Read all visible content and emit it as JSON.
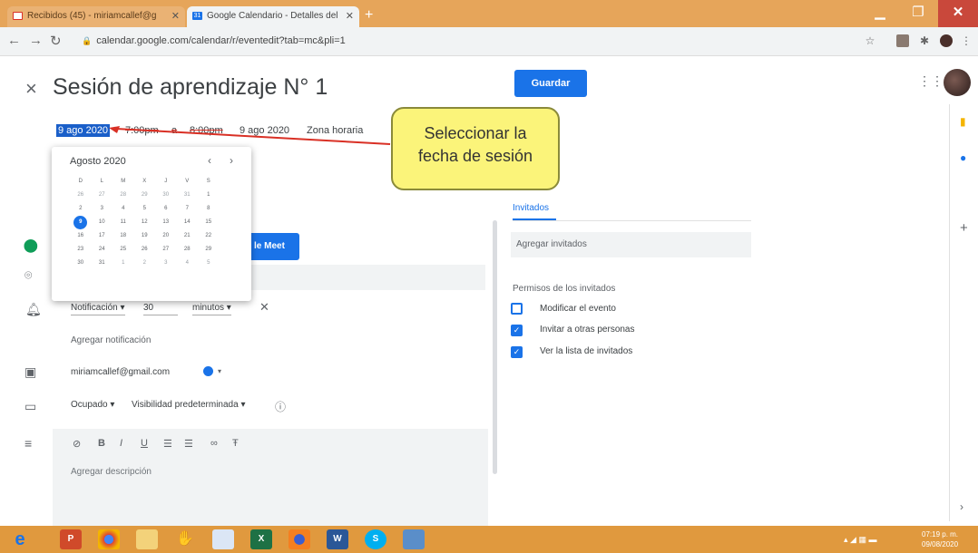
{
  "browser": {
    "tabs": [
      {
        "title": "Recibidos (45) - miriamcallef@g",
        "active": false
      },
      {
        "title": "Google Calendario - Detalles del",
        "active": true
      }
    ],
    "url": "calendar.google.com/calendar/r/eventedit?tab=mc&pli=1"
  },
  "event": {
    "title": "Sesión de aprendizaje N° 1",
    "save_label": "Guardar",
    "start_date": "9 ago 2020",
    "start_time": "7:00pm",
    "separator": "a",
    "end_time": "8:00pm",
    "end_date": "9 ago 2020",
    "timezone_label": "Zona horaria"
  },
  "callout": {
    "line1": "Seleccionar la",
    "line2": "fecha de sesión"
  },
  "datepicker": {
    "month_label": "Agosto 2020",
    "weekdays": [
      "D",
      "L",
      "M",
      "X",
      "J",
      "V",
      "S"
    ],
    "weeks": [
      [
        "26",
        "27",
        "28",
        "29",
        "30",
        "31",
        "1"
      ],
      [
        "2",
        "3",
        "4",
        "5",
        "6",
        "7",
        "8"
      ],
      [
        "9",
        "10",
        "11",
        "12",
        "13",
        "14",
        "15"
      ],
      [
        "16",
        "17",
        "18",
        "19",
        "20",
        "21",
        "22"
      ],
      [
        "23",
        "24",
        "25",
        "26",
        "27",
        "28",
        "29"
      ],
      [
        "30",
        "31",
        "1",
        "2",
        "3",
        "4",
        "5"
      ]
    ],
    "selected": "9"
  },
  "details": {
    "meet_label": "le Meet",
    "notification_type": "Notificación",
    "notification_value": "30",
    "notification_unit": "minutos",
    "add_notification": "Agregar notificación",
    "calendar_owner": "miriamcallef@gmail.com",
    "busy_label": "Ocupado",
    "visibility_label": "Visibilidad predeterminada",
    "description_placeholder": "Agregar descripción"
  },
  "guests": {
    "tab_label": "Invitados",
    "add_placeholder": "Agregar invitados",
    "permissions_title": "Permisos de los invitados",
    "permissions": [
      {
        "label": "Modificar el evento",
        "checked": false
      },
      {
        "label": "Invitar a otras personas",
        "checked": true
      },
      {
        "label": "Ver la lista de invitados",
        "checked": true
      }
    ]
  },
  "taskbar": {
    "clock_time": "07:19 p. m.",
    "clock_date": "09/08/2020"
  },
  "colors": {
    "accent": "#1a73e8",
    "callout": "#fbf47a",
    "taskbar": "#e0993e"
  }
}
